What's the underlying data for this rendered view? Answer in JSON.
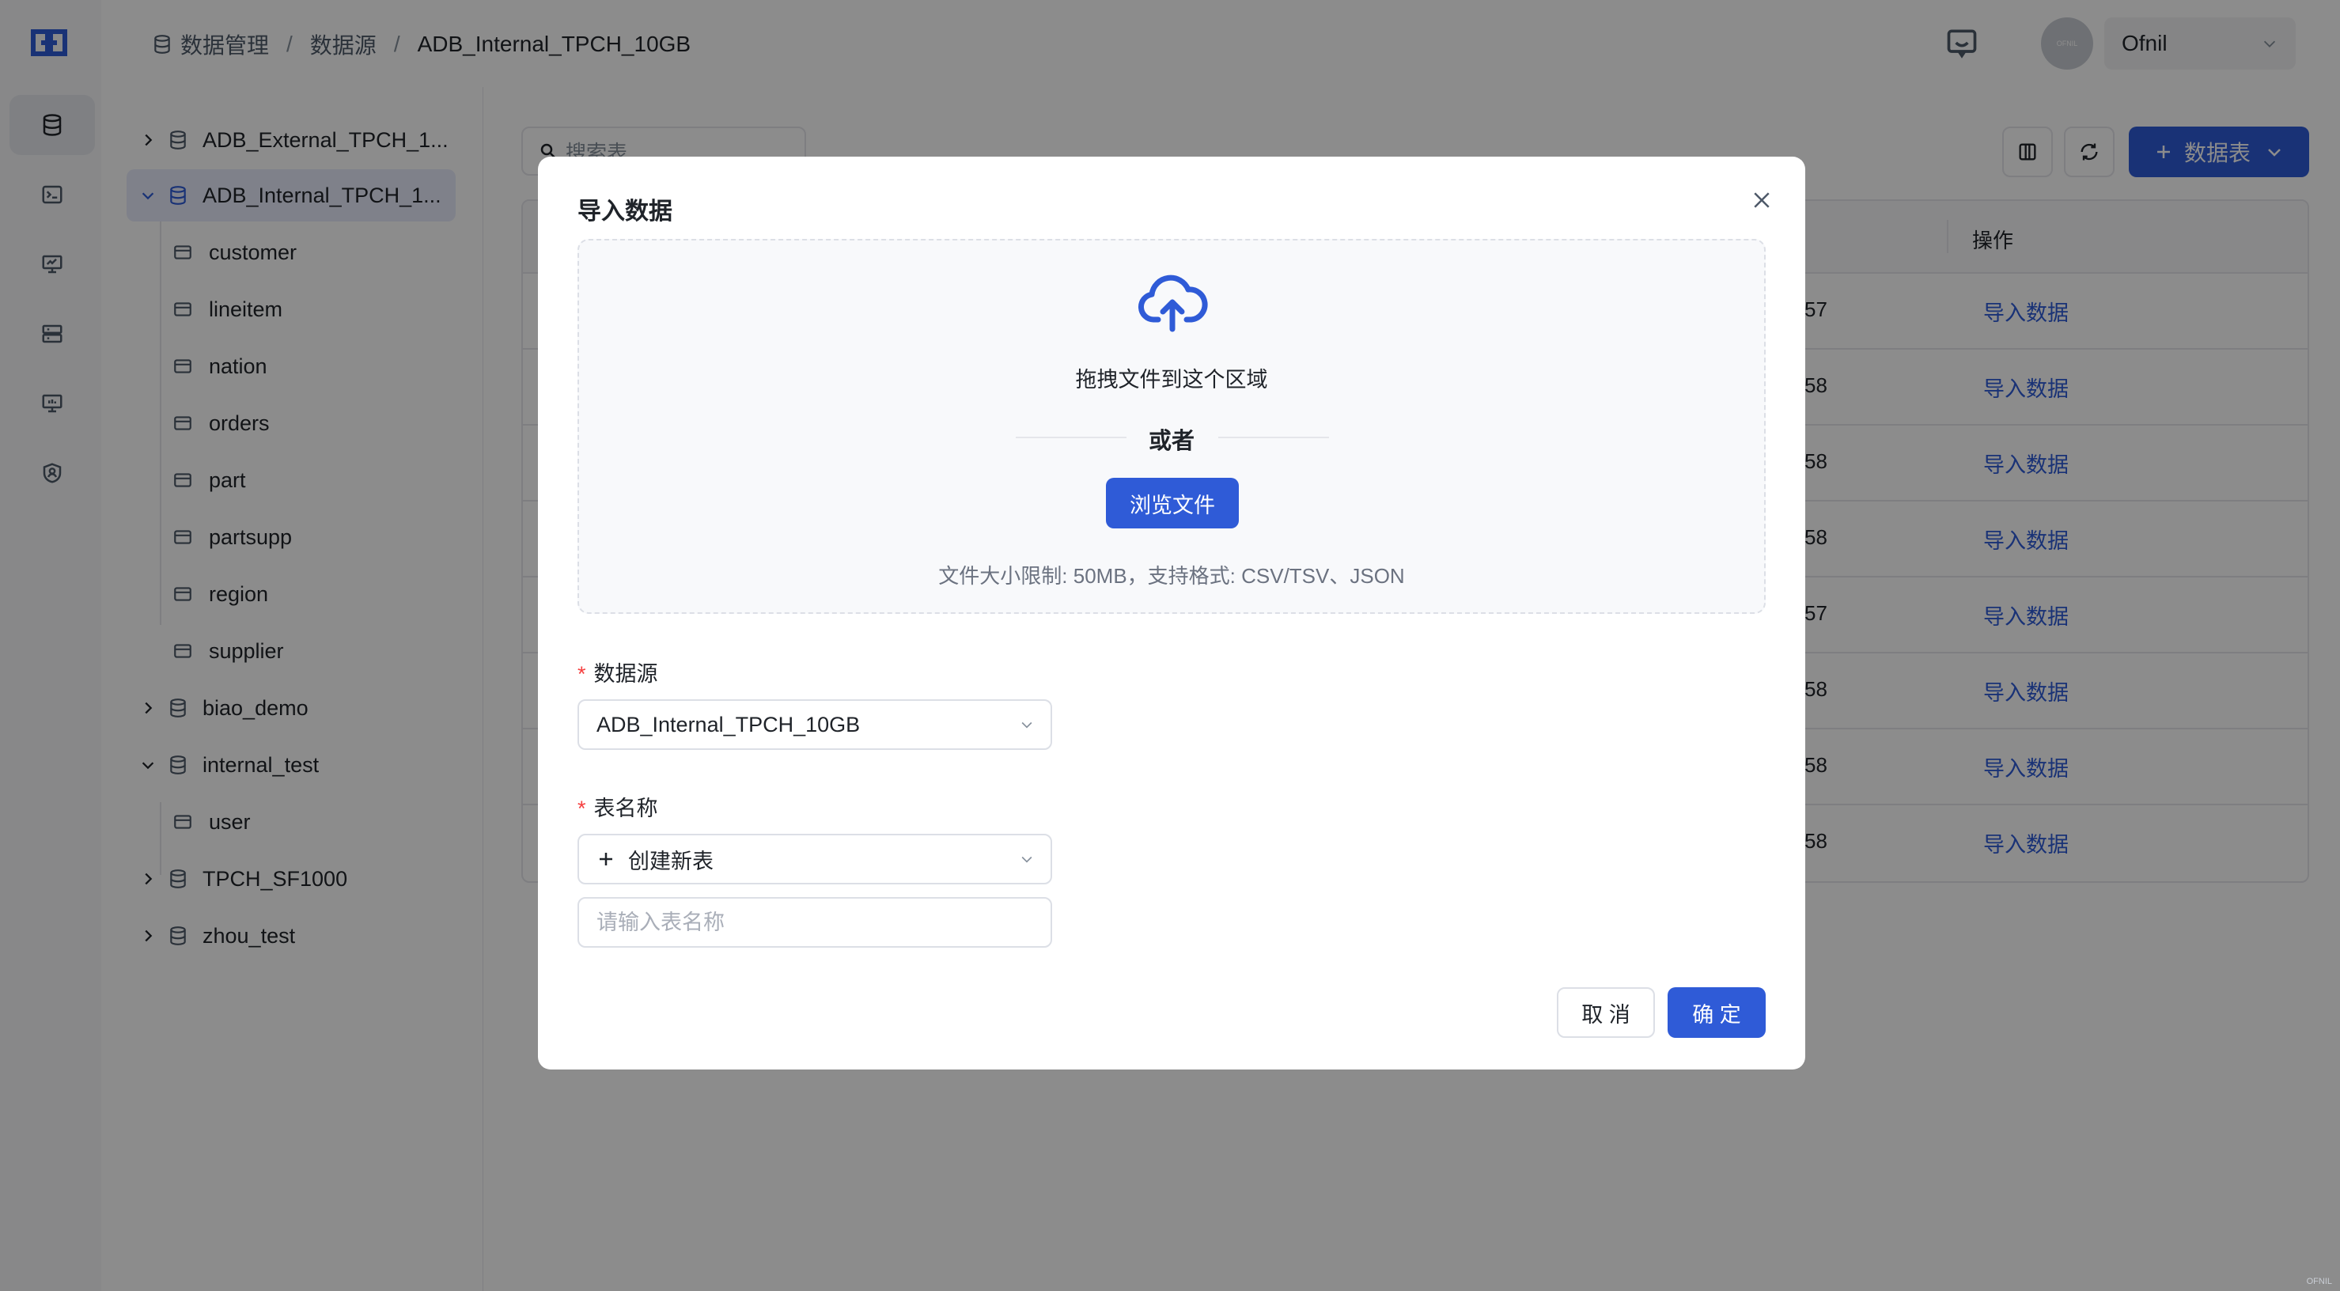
{
  "header": {
    "breadcrumb": [
      "数据管理",
      "数据源",
      "ADB_Internal_TPCH_10GB"
    ],
    "user": "Ofnil",
    "avatar_text": "OFNIL"
  },
  "rail": {
    "items": [
      "database-icon",
      "terminal-icon",
      "presentation-icon",
      "server-icon",
      "monitor-icon",
      "shield-user-icon"
    ]
  },
  "tree": {
    "nodes": [
      {
        "label": "ADB_External_TPCH_1...",
        "type": "database",
        "expanded": false
      },
      {
        "label": "ADB_Internal_TPCH_1...",
        "type": "database",
        "expanded": true,
        "selected": true
      },
      {
        "label": "customer",
        "type": "table"
      },
      {
        "label": "lineitem",
        "type": "table"
      },
      {
        "label": "nation",
        "type": "table"
      },
      {
        "label": "orders",
        "type": "table"
      },
      {
        "label": "part",
        "type": "table"
      },
      {
        "label": "partsupp",
        "type": "table"
      },
      {
        "label": "region",
        "type": "table"
      },
      {
        "label": "supplier",
        "type": "table"
      },
      {
        "label": "biao_demo",
        "type": "database",
        "expanded": false
      },
      {
        "label": "internal_test",
        "type": "database",
        "expanded": true
      },
      {
        "label": "user",
        "type": "table"
      },
      {
        "label": "TPCH_SF1000",
        "type": "database",
        "expanded": false
      },
      {
        "label": "zhou_test",
        "type": "database",
        "expanded": false
      }
    ]
  },
  "main": {
    "search_placeholder": "搜索表",
    "new_table_label": "数据表",
    "op_header": "操作",
    "rows": [
      {
        "time_suffix": "57",
        "action": "导入数据"
      },
      {
        "time_suffix": "58",
        "action": "导入数据"
      },
      {
        "time_suffix": "58",
        "action": "导入数据"
      },
      {
        "time_suffix": "58",
        "action": "导入数据"
      },
      {
        "time_suffix": "57",
        "action": "导入数据"
      },
      {
        "time_suffix": "58",
        "action": "导入数据"
      },
      {
        "time_suffix": "58",
        "action": "导入数据"
      },
      {
        "time_suffix": "58",
        "action": "导入数据"
      }
    ]
  },
  "modal": {
    "title": "导入数据",
    "drag_text": "拖拽文件到这个区域",
    "or_text": "或者",
    "browse_label": "浏览文件",
    "limit_text": "文件大小限制: 50MB，支持格式: CSV/TSV、JSON",
    "datasource_label": "数据源",
    "datasource_value": "ADB_Internal_TPCH_10GB",
    "tablename_label": "表名称",
    "create_new_label": "创建新表",
    "tablename_placeholder": "请输入表名称",
    "cancel_label": "取 消",
    "ok_label": "确 定",
    "required_mark": "*"
  },
  "colors": {
    "primary": "#2f5bd7",
    "required": "#f53f3f"
  },
  "watermark": "OFNIL"
}
